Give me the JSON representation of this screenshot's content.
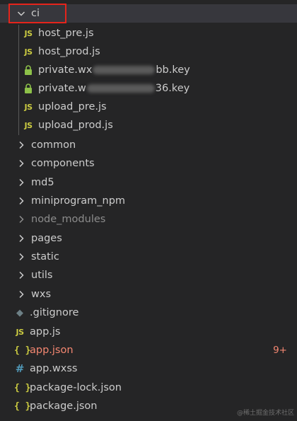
{
  "explorer": {
    "root_folder": {
      "label": "ci"
    },
    "ci_children": [
      {
        "label": "host_pre.js",
        "icon": "JS"
      },
      {
        "label": "host_prod.js",
        "icon": "JS"
      },
      {
        "label_start": "private.wx",
        "label_end": "bb.key",
        "icon": "lock-icon"
      },
      {
        "label_start": "private.w",
        "label_end": "36.key",
        "icon": "lock-icon"
      },
      {
        "label": "upload_pre.js",
        "icon": "JS"
      },
      {
        "label": "upload_prod.js",
        "icon": "JS"
      }
    ],
    "folders": [
      {
        "label": "common"
      },
      {
        "label": "components"
      },
      {
        "label": "md5"
      },
      {
        "label": "miniprogram_npm"
      },
      {
        "label": "node_modules"
      },
      {
        "label": "pages"
      },
      {
        "label": "static"
      },
      {
        "label": "utils"
      },
      {
        "label": "wxs"
      }
    ],
    "files": [
      {
        "label": ".gitignore",
        "icon": "◆"
      },
      {
        "label": "app.js",
        "icon": "JS"
      },
      {
        "label": "app.json",
        "icon": "{ }",
        "badge": "9+"
      },
      {
        "label": "app.wxss",
        "icon": "#"
      },
      {
        "label": "package-lock.json",
        "icon": "{ }"
      },
      {
        "label": "package.json",
        "icon": "{ }"
      }
    ]
  },
  "colors": {
    "background": "#252526",
    "selected_row": "#37373d",
    "js_icon": "#cbcb41",
    "error_text": "#f48771",
    "highlight_box": "#e5241b"
  },
  "watermark": "@稀土掘金技术社区"
}
